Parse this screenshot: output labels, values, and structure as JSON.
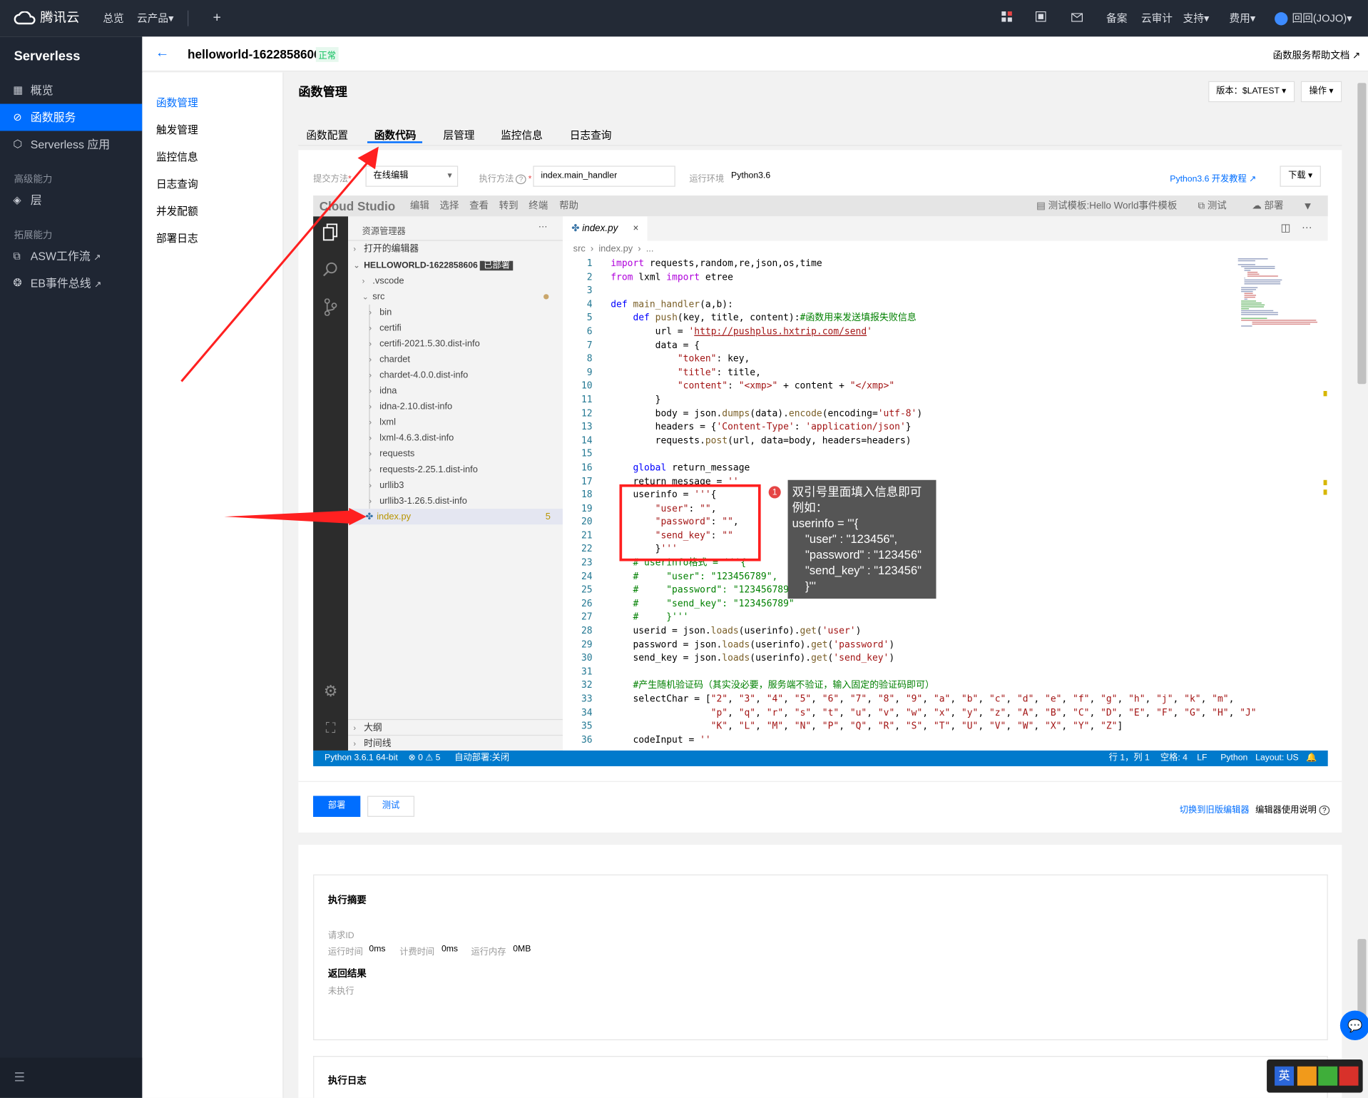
{
  "topbar": {
    "brand": "腾讯云",
    "overview": "总览",
    "products": "云产品",
    "products_caret": "▾",
    "plus": "+",
    "beian": "备案",
    "audit": "云审计",
    "support": "支持",
    "billing": "费用",
    "user": "回回(JOJO)",
    "caret": "▾"
  },
  "leftnav": {
    "title": "Serverless",
    "items": [
      {
        "label": "概览",
        "icon": "grid-icon"
      },
      {
        "label": "函数服务",
        "icon": "function-icon"
      },
      {
        "label": "Serverless 应用",
        "icon": "app-icon"
      }
    ],
    "group1": "高级能力",
    "layer": "层",
    "group2": "拓展能力",
    "asw": "ASW工作流",
    "eb": "EB事件总线",
    "external": "↗",
    "collapse": "☰"
  },
  "header": {
    "back": "←",
    "function_name": "helloworld-1622858606",
    "status": "正常",
    "help": "函数服务帮助文档",
    "help_icon": "↗"
  },
  "subnav": [
    "函数管理",
    "触发管理",
    "监控信息",
    "日志查询",
    "并发配额",
    "部署日志"
  ],
  "main": {
    "title": "函数管理",
    "version": "版本：$LATEST",
    "operate": "操作",
    "caret": "▾",
    "tabs": [
      "函数配置",
      "函数代码",
      "层管理",
      "监控信息",
      "日志查询"
    ]
  },
  "form": {
    "submit_label": "提交方法",
    "submit_value": "在线编辑",
    "handler_label": "执行方法",
    "handler_value": "index.main_handler",
    "runtime_label": "运行环境",
    "runtime_value": "Python3.6",
    "tutorial": "Python3.6 开发教程",
    "download": "下载",
    "required": "*",
    "help_mark": "?"
  },
  "ide": {
    "brand": "Cloud Studio",
    "menu": [
      "编辑",
      "选择",
      "查看",
      "转到",
      "终端",
      "帮助"
    ],
    "test_template": "测试模板:Hello World事件模板",
    "test": "测试",
    "deploy": "部署",
    "explorer_title": "资源管理器",
    "more": "···",
    "open_editors": "打开的编辑器",
    "root": "HELLOWORLD-1622858606",
    "deployed": "已部署",
    "tree": [
      ".vscode",
      "src",
      "bin",
      "certifi",
      "certifi-2021.5.30.dist-info",
      "chardet",
      "chardet-4.0.0.dist-info",
      "idna",
      "idna-2.10.dist-info",
      "lxml",
      "lxml-4.6.3.dist-info",
      "requests",
      "requests-2.25.1.dist-info",
      "urllib3",
      "urllib3-1.26.5.dist-info",
      "index.py"
    ],
    "index_badge": "5",
    "outline": "大纲",
    "timeline": "时间线",
    "tab_file": "index.py",
    "close": "×",
    "breadcrumb": "src  ›  index.py  ›  ...",
    "status_left": [
      "Python 3.6.1 64-bit",
      "⊗ 0 ⚠ 5",
      "自动部署:关闭"
    ],
    "status_right": [
      "行 1，列 1",
      "空格: 4",
      "LF",
      "Python",
      "Layout: US",
      "🔔"
    ]
  },
  "code": [
    "import requests,random,re,json,os,time",
    "from lxml import etree",
    "",
    "def main_handler(a,b):",
    "    def push(key, title, content):#函数用来发送填报失败信息",
    "        url = 'http://pushplus.hxtrip.com/send'",
    "        data = {",
    "            \"token\": key,",
    "            \"title\": title,",
    "            \"content\": \"<xmp>\" + content + \"</xmp>\"",
    "        }",
    "        body = json.dumps(data).encode(encoding='utf-8')",
    "        headers = {'Content-Type': 'application/json'}",
    "        requests.post(url, data=body, headers=headers)",
    "",
    "    global return_message",
    "    return_message = ''",
    "    userinfo = '''{",
    "        \"user\": \"\",",
    "        \"password\": \"\",",
    "        \"send_key\": \"\"",
    "        }'''",
    "    # userinfo格式 = '''{",
    "    #     \"user\": \"123456789\",",
    "    #     \"password\": \"123456789\",",
    "    #     \"send_key\": \"123456789\"",
    "    #     }'''",
    "    userid = json.loads(userinfo).get('user')",
    "    password = json.loads(userinfo).get('password')",
    "    send_key = json.loads(userinfo).get('send_key')",
    "",
    "    #产生随机验证码（其实没必要，服务端不验证，输入固定的验证码即可）",
    "    selectChar = [\"2\", \"3\", \"4\", \"5\", \"6\", \"7\", \"8\", \"9\", \"a\", \"b\", \"c\", \"d\", \"e\", \"f\", \"g\", \"h\", \"j\", \"k\", \"m\",",
    "                  \"p\", \"q\", \"r\", \"s\", \"t\", \"u\", \"v\", \"w\", \"x\", \"y\", \"z\", \"A\", \"B\", \"C\", \"D\", \"E\", \"F\", \"G\", \"H\", \"J\"",
    "                  \"K\", \"L\", \"M\", \"N\", \"P\", \"Q\", \"R\", \"S\", \"T\", \"U\", \"V\", \"W\", \"X\", \"Y\", \"Z\"]",
    "    codeInput = ''"
  ],
  "annotation": {
    "badge": "1",
    "lines": [
      "双引号里面填入信息即可",
      "例如：",
      "userinfo = '''{",
      "    \"user\" : \"123456\",",
      "    \"password\" : \"123456\"",
      "    \"send_key\" : \"123456\"",
      "    }'''"
    ]
  },
  "actions": {
    "deploy": "部署",
    "test": "测试",
    "switch_editor": "切换到旧版编辑器",
    "editor_help": "编辑器使用说明"
  },
  "summary": {
    "title": "执行摘要",
    "request_id_label": "请求ID",
    "run_time_label": "运行时间",
    "run_time": "0ms",
    "billed_time_label": "计费时间",
    "billed_time": "0ms",
    "memory_label": "运行内存",
    "memory": "0MB",
    "result_title": "返回结果",
    "result": "未执行",
    "log_title": "执行日志"
  },
  "ime": {
    "lang": "英",
    "chat_icon": "💬"
  },
  "colors": {
    "accent": "#006eff",
    "nav_bg": "#1f2633",
    "topbar_bg": "#232a36",
    "status_blue": "#007acc",
    "annotation_red": "#ff1f1f"
  }
}
